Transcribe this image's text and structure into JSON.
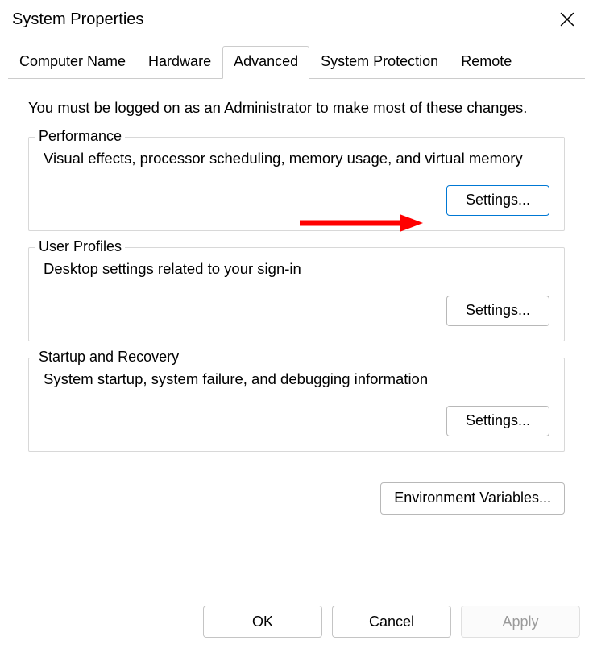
{
  "title": "System Properties",
  "tabs": [
    {
      "label": "Computer Name"
    },
    {
      "label": "Hardware"
    },
    {
      "label": "Advanced"
    },
    {
      "label": "System Protection"
    },
    {
      "label": "Remote"
    }
  ],
  "active_tab_index": 2,
  "advanced": {
    "intro": "You must be logged on as an Administrator to make most of these changes.",
    "performance": {
      "legend": "Performance",
      "desc": "Visual effects, processor scheduling, memory usage, and virtual memory",
      "button": "Settings..."
    },
    "user_profiles": {
      "legend": "User Profiles",
      "desc": "Desktop settings related to your sign-in",
      "button": "Settings..."
    },
    "startup_recovery": {
      "legend": "Startup and Recovery",
      "desc": "System startup, system failure, and debugging information",
      "button": "Settings..."
    },
    "env_button": "Environment Variables..."
  },
  "buttons": {
    "ok": "OK",
    "cancel": "Cancel",
    "apply": "Apply"
  },
  "annotation": {
    "arrow_color": "#ff0000"
  }
}
